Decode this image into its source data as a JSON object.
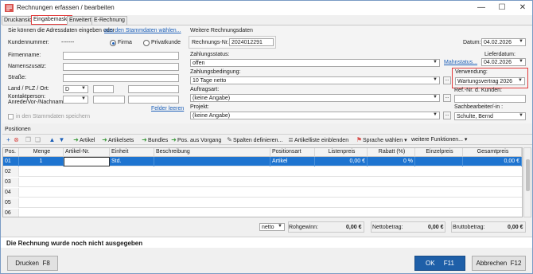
{
  "window": {
    "title": "Rechnungen erfassen / bearbeiten",
    "min": "—",
    "max": "☐",
    "close": "✕"
  },
  "tabs": [
    "Druckansicht",
    "Eingabemaske",
    "Erweitert",
    "E-Rechnung"
  ],
  "address": {
    "hint": "Sie können die Adressdaten eingeben oder",
    "hint_link": "aus den Stammdaten wählen...",
    "customer_no_label": "Kundennummer:",
    "customer_no_value": "-------",
    "radio_firma": "Firma",
    "radio_privat": "Privatkunde",
    "firmenname": "Firmenname:",
    "namenszusatz": "Namenszusatz:",
    "strasse": "Straße:",
    "land_plz_ort": "Land / PLZ / Ort:",
    "land_value": "D",
    "kontaktperson": "Kontaktperson:",
    "anrede": "Anrede/Vor-/Nachname",
    "felder_leeren": "Felder leeren",
    "save_master": "in den Stammdaten speichern"
  },
  "invoice": {
    "section": "Weitere Rechnungsdaten",
    "nr_label": "Rechnungs-Nr.:",
    "nr_value": "2024012291",
    "datum_label": "Datum:",
    "datum_value": "04.02.2026",
    "zahlungsstatus_label": "Zahlungsstatus:",
    "zahlungsstatus_value": "offen",
    "mahnstatus": "Mahnstatus...",
    "lieferdatum_label": "Lieferdatum:",
    "lieferdatum_value": "04.02.2026",
    "zahlungsbedingung_label": "Zahlungsbedingung:",
    "zahlungsbedingung_value": "10 Tage netto",
    "verwendung_label": "Verwendung:",
    "verwendung_value": "Wartungsvertrag 2026",
    "auftragsart_label": "Auftragsart:",
    "auftragsart_value": "(keine Angabe)",
    "refnr_label": "Ref.-Nr. d. Kunden:",
    "projekt_label": "Projekt:",
    "projekt_value": "(keine Angabe)",
    "sachbearbeiter_label": "Sachbearbeiter/-in :",
    "sachbearbeiter_value": "Schulte, Bernd",
    "dots": "..."
  },
  "positions": {
    "title": "Positionen",
    "toolbar": {
      "artikel": "Artikel",
      "artikelsets": "Artikelsets",
      "bundles": "Bundles",
      "pos_vorgang": "Pos. aus Vorgang",
      "spalten": "Spalten definieren...",
      "artikelliste": "Artikelliste einblenden",
      "sprache": "Sprache wählen",
      "weitere": "weitere Funktionen..."
    },
    "columns": [
      "Pos.",
      "Menge",
      "Artikel-Nr.",
      "Einheit",
      "Beschreibung",
      "Positionsart",
      "Listenpreis",
      "Rabatt (%)",
      "Einzelpreis",
      "Gesamtpreis"
    ],
    "rows": [
      {
        "pos": "01",
        "menge": "1",
        "artikel": "",
        "einheit": "Std.",
        "beschreibung": "",
        "art": "Artikel",
        "listenpreis": "0,00 €",
        "rabatt": "0 %",
        "einzelpreis": "",
        "gesamtpreis": "0,00 €"
      },
      {
        "pos": "02"
      },
      {
        "pos": "03"
      },
      {
        "pos": "04"
      },
      {
        "pos": "05"
      },
      {
        "pos": "06"
      }
    ]
  },
  "totals": {
    "mode": "netto",
    "rohgewinn_label": "Rohgewinn:",
    "rohgewinn_value": "0,00 €",
    "netto_label": "Nettobetrag:",
    "netto_value": "0,00 €",
    "brutto_label": "Bruttobetrag:",
    "brutto_value": "0,00 €"
  },
  "status_message": "Die Rechnung wurde noch nicht ausgegeben",
  "buttons": {
    "drucken": "Drucken",
    "drucken_key": "F8",
    "ok": "OK",
    "ok_key": "F11",
    "abbrechen": "Abbrechen",
    "abbrechen_key": "F12"
  },
  "colors": {
    "accent": "#1e74d0",
    "highlight": "#e23b3b",
    "link": "#1c5fb8"
  }
}
